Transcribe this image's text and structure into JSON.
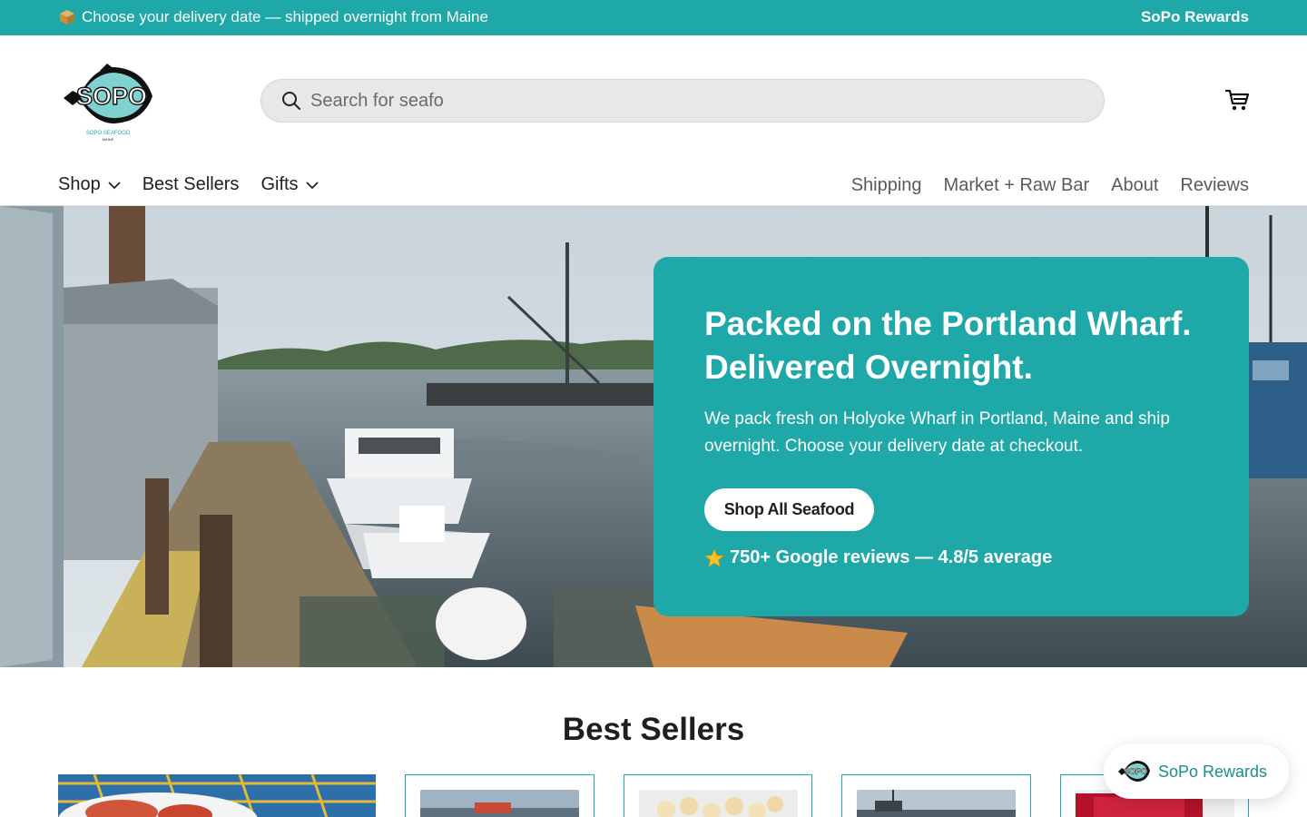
{
  "announcement": {
    "icon": "package-icon",
    "message": "Choose your delivery date — shipped overnight from Maine",
    "rewards_link": "SoPo Rewards"
  },
  "header": {
    "logo_text": "SOPO",
    "logo_subtext": "SOPO SEAFOOD",
    "logo_subtext2": "MAINE",
    "search_placeholder": "Search for seafo",
    "cart_icon": "cart-icon"
  },
  "nav": {
    "left": [
      {
        "label": "Shop",
        "has_dropdown": true
      },
      {
        "label": "Best Sellers",
        "has_dropdown": false
      },
      {
        "label": "Gifts",
        "has_dropdown": true
      }
    ],
    "right": [
      {
        "label": "Shipping"
      },
      {
        "label": "Market + Raw Bar"
      },
      {
        "label": "About"
      },
      {
        "label": "Reviews"
      }
    ]
  },
  "hero": {
    "title_line1": "Packed on the Portland Wharf.",
    "title_line2": "Delivered Overnight.",
    "description": "We pack fresh on Holyoke Wharf in Portland, Maine and ship overnight. Choose your delivery date at checkout.",
    "cta_label": "Shop All Seafood",
    "reviews_text": "750+ Google reviews — 4.8/5 average"
  },
  "best_sellers": {
    "title": "Best Sellers",
    "products": [
      {
        "name": "product-1",
        "image": "lobster-tray-image"
      },
      {
        "name": "product-2",
        "image": "harbor-image"
      },
      {
        "name": "product-3",
        "image": "scallops-image"
      },
      {
        "name": "product-4",
        "image": "wharf-image"
      },
      {
        "name": "product-5",
        "image": "tuna-image"
      }
    ]
  },
  "floating_widget": {
    "label": "SoPo Rewards"
  },
  "colors": {
    "brand_teal": "#1fa8a8",
    "text_dark": "#1f1f1f",
    "nav_muted": "#5a5a5a"
  }
}
